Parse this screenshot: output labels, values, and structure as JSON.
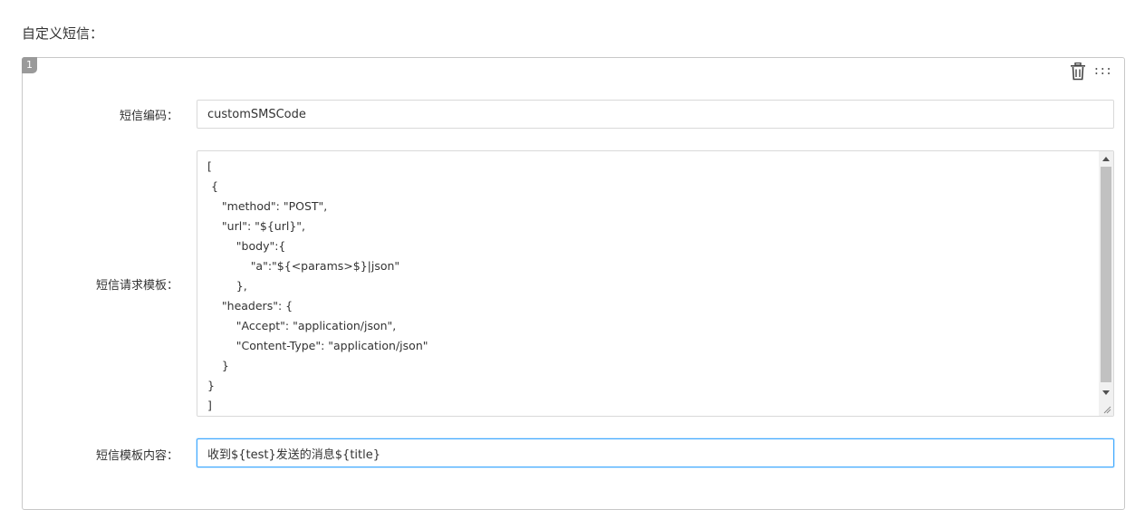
{
  "section_title": "自定义短信：",
  "panel": {
    "index": "1",
    "toolbar": {
      "delete_icon": "trash-icon",
      "drag_icon_glyph": ":::"
    },
    "fields": {
      "code": {
        "label": "短信编码：",
        "value": "customSMSCode"
      },
      "request_template": {
        "label": "短信请求模板：",
        "value": "[\n {\n\t\"method\": \"POST\",\n\t\"url\": \"${url}\",\n\t\t\"body\":{\n\t\t\t\"a\":\"${<params>$}|json\"\n\t\t},\n\t\"headers\": {\n\t    \"Accept\": \"application/json\",\n\t    \"Content-Type\": \"application/json\"\n\t}\n}\n]"
      },
      "template_content": {
        "label": "短信模板内容：",
        "value": "收到${test}发送的消息${title}"
      }
    }
  },
  "colors": {
    "focus_border": "#40a9ff",
    "input_border": "#d9d9d9",
    "badge_bg": "#9a9a9a"
  }
}
